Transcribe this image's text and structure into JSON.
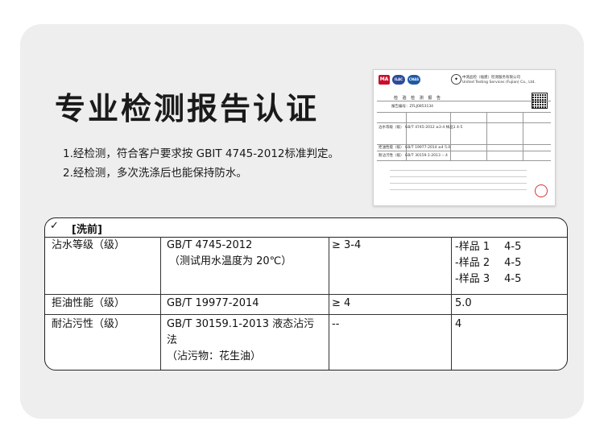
{
  "heading": "专业检测报告认证",
  "bullets": [
    "1.经检测，符合客户要求按 GBIT 4745-2012标准判定。",
    "2.经检测，多次洗涤后也能保持防水。"
  ],
  "report": {
    "logo_ma": "MA",
    "logo_ilac": "ILAC",
    "logo_cnas": "CNAS",
    "company_cn": "中测品检（福建）检测服务有限公司",
    "company_en": "United Testing Services (Fujian) Co., Ltd.",
    "title": "检 验 检 测 报 告",
    "report_no": "报告编号：ZFLJ0853134",
    "rows": [
      "沾水等级（级）  GB/T 4745-2012   ≥3-4   样品1 4-5",
      "拒油性能（级）  GB/T 19977-2014   ≥4   5.0",
      "耐沾污性（级）  GB/T 30159.1-2013   --   4"
    ]
  },
  "table": {
    "check": "✓",
    "header": "[洗前]",
    "rows": [
      {
        "item": "沾水等级（级）",
        "method_line1": "GB/T 4745-2012",
        "method_line2": "（测试用水温度为 20℃）",
        "requirement": "≥ 3-4",
        "results": [
          {
            "label": "-样品 1",
            "value": "4-5"
          },
          {
            "label": "-样品 2",
            "value": "4-5"
          },
          {
            "label": "-样品 3",
            "value": "4-5"
          }
        ]
      },
      {
        "item": "拒油性能（级）",
        "method_line1": "GB/T 19977-2014",
        "requirement": "≥ 4",
        "result": "5.0"
      },
      {
        "item": "耐沾污性（级）",
        "method_line1": "GB/T 30159.1-2013 液态沾污",
        "method_line2": "法",
        "method_line3": "（沾污物：花生油）",
        "requirement": "--",
        "result": "4"
      }
    ]
  }
}
